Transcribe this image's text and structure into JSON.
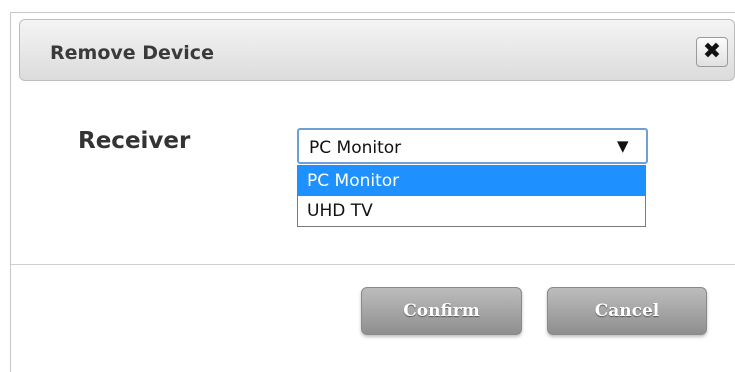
{
  "dialog": {
    "title": "Remove Device",
    "close_glyph": "✖"
  },
  "form": {
    "receiver_label": "Receiver",
    "select": {
      "value": "PC Monitor",
      "arrow_glyph": "▼"
    },
    "dropdown_options": [
      {
        "label": "PC Monitor",
        "selected": true
      },
      {
        "label": "UHD TV",
        "selected": false
      }
    ]
  },
  "buttons": {
    "confirm_label": "Confirm",
    "cancel_label": "Cancel"
  },
  "colors": {
    "selected_option_bg": "#1e90ff",
    "select_border": "#6f9fd8",
    "button_bg": "#a6a6a6"
  }
}
